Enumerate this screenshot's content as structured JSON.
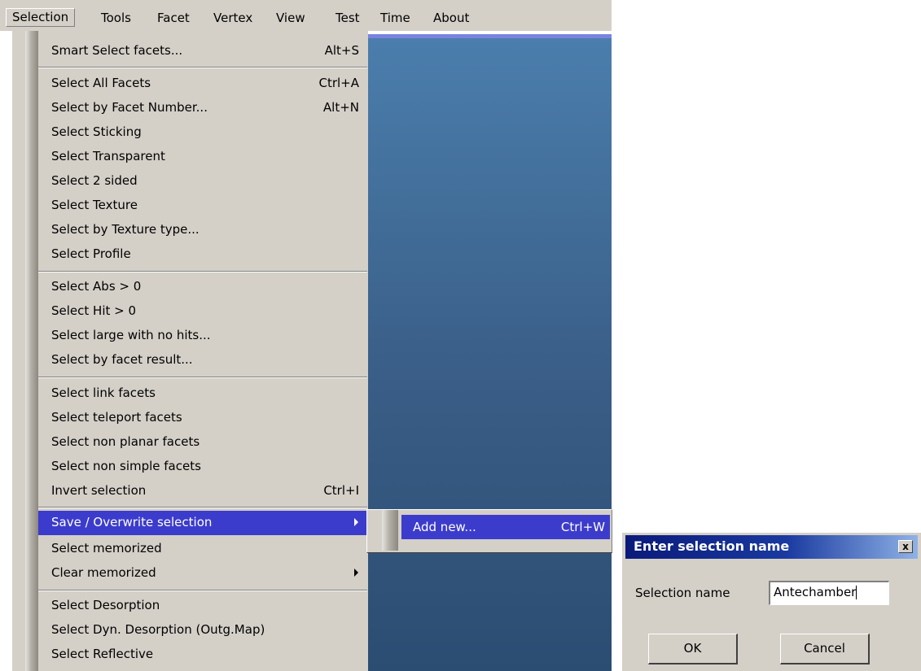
{
  "menubar": {
    "items": [
      "Selection",
      "Tools",
      "Facet",
      "Vertex",
      "View",
      "Test",
      "Time",
      "About"
    ]
  },
  "menu": {
    "items": [
      {
        "label": "Smart Select facets...",
        "shortcut": "Alt+S"
      },
      {
        "label": "Select All Facets",
        "shortcut": "Ctrl+A"
      },
      {
        "label": "Select by Facet Number...",
        "shortcut": "Alt+N"
      },
      {
        "label": "Select Sticking",
        "shortcut": ""
      },
      {
        "label": "Select Transparent",
        "shortcut": ""
      },
      {
        "label": "Select 2 sided",
        "shortcut": ""
      },
      {
        "label": "Select Texture",
        "shortcut": ""
      },
      {
        "label": "Select by Texture type...",
        "shortcut": ""
      },
      {
        "label": "Select Profile",
        "shortcut": ""
      },
      {
        "label": "Select Abs > 0",
        "shortcut": ""
      },
      {
        "label": "Select Hit > 0",
        "shortcut": ""
      },
      {
        "label": "Select large with no hits...",
        "shortcut": ""
      },
      {
        "label": "Select by facet result...",
        "shortcut": ""
      },
      {
        "label": "Select link facets",
        "shortcut": ""
      },
      {
        "label": "Select teleport facets",
        "shortcut": ""
      },
      {
        "label": "Select non planar facets",
        "shortcut": ""
      },
      {
        "label": "Select non simple facets",
        "shortcut": ""
      },
      {
        "label": "Invert selection",
        "shortcut": "Ctrl+I"
      },
      {
        "label": "Save / Overwrite selection",
        "shortcut": ""
      },
      {
        "label": "Select memorized",
        "shortcut": ""
      },
      {
        "label": "Clear memorized",
        "shortcut": ""
      },
      {
        "label": "Select Desorption",
        "shortcut": ""
      },
      {
        "label": "Select Dyn. Desorption (Outg.Map)",
        "shortcut": ""
      },
      {
        "label": "Select Reflective",
        "shortcut": ""
      }
    ]
  },
  "submenu": {
    "label": "Add new...",
    "shortcut": "Ctrl+W"
  },
  "dialog": {
    "title": "Enter selection name",
    "close_glyph": "x",
    "field_label": "Selection name",
    "field_value": "Antechamber",
    "ok_label": "OK",
    "cancel_label": "Cancel"
  }
}
